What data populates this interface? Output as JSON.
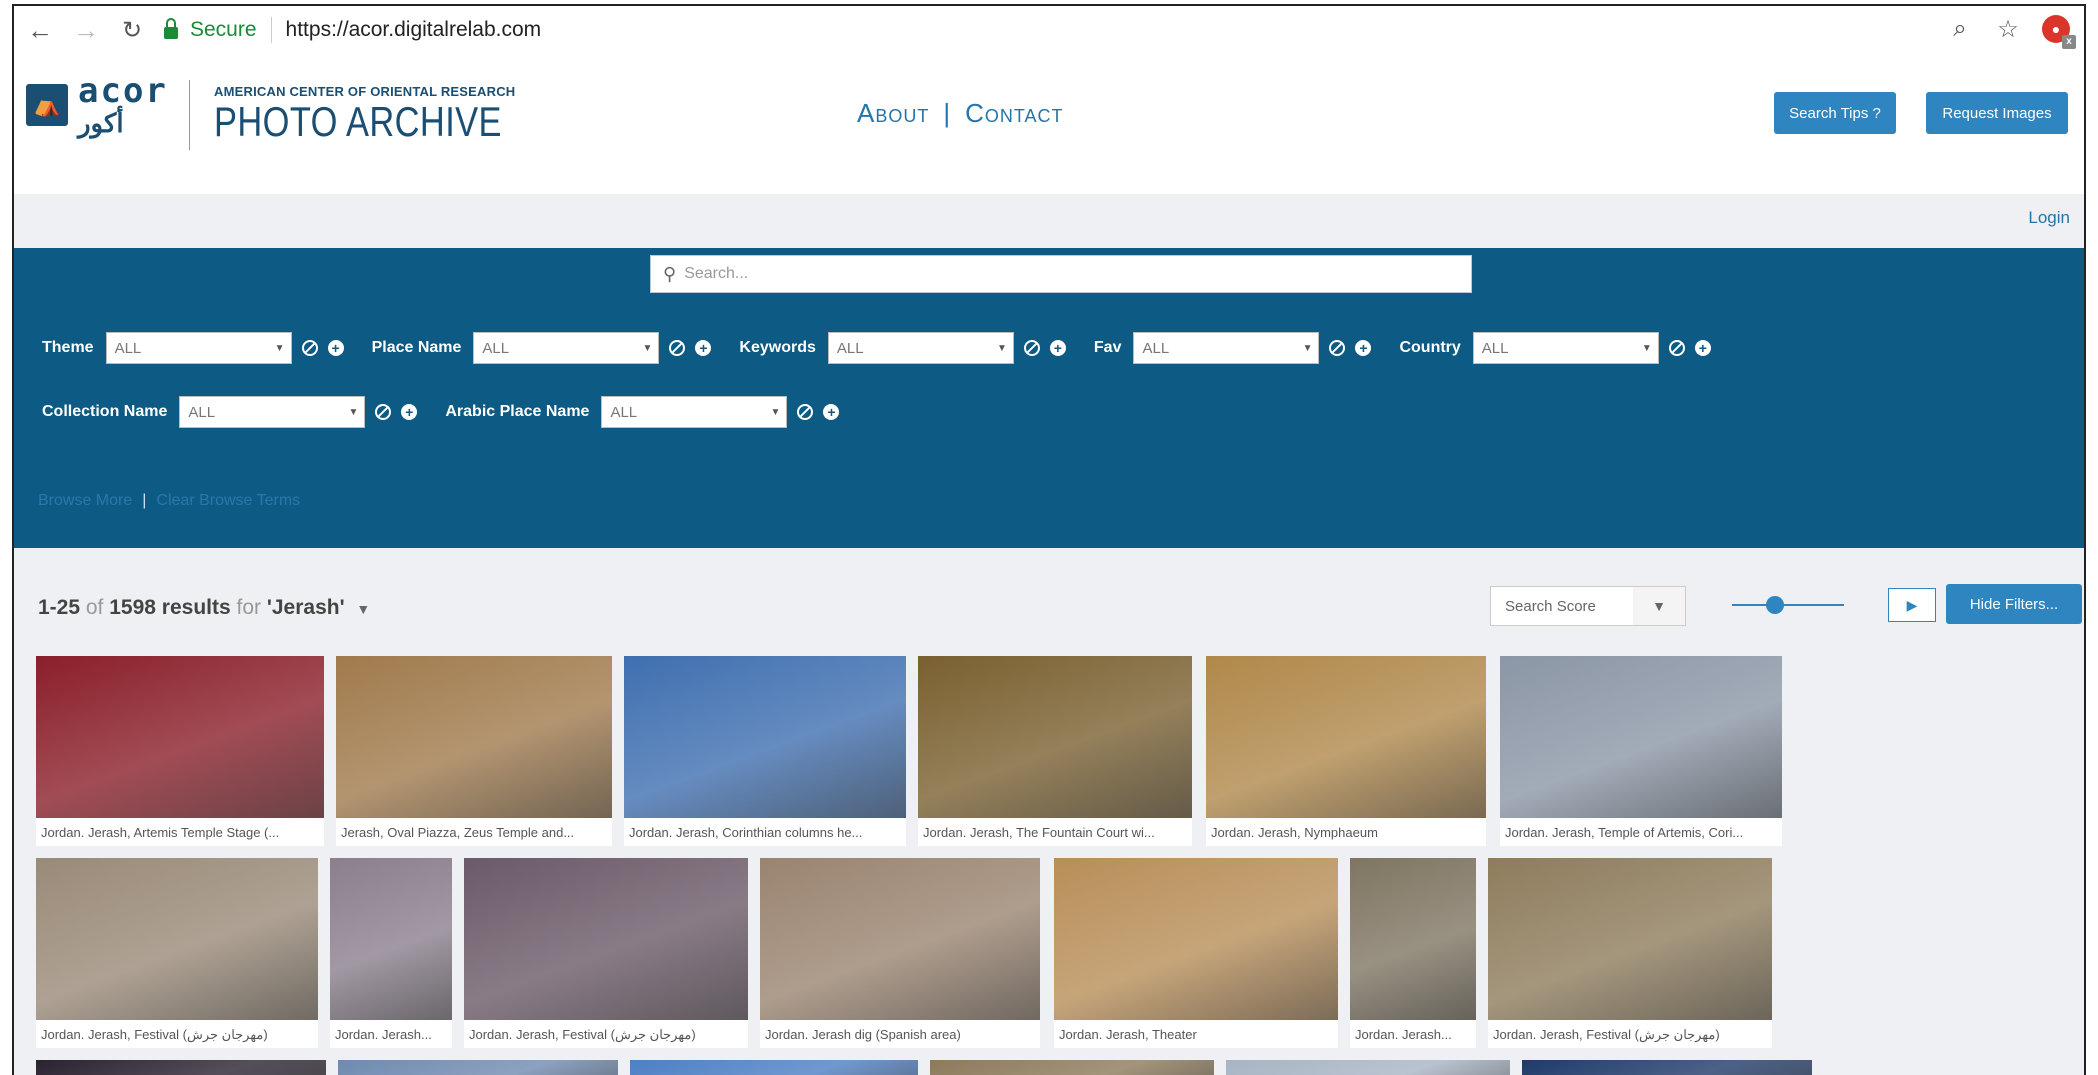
{
  "browser": {
    "secure_label": "Secure",
    "url": "https://acor.digitalrelab.com"
  },
  "header": {
    "logo_en": "acor",
    "logo_ar": "أكور",
    "subtitle": "AMERICAN CENTER OF ORIENTAL RESEARCH",
    "title": "PHOTO ARCHIVE",
    "nav": {
      "about": "About",
      "contact": "Contact",
      "separator": "|"
    },
    "search_tips_label": "Search Tips ?",
    "request_images_label": "Request Images"
  },
  "login_label": "Login",
  "search": {
    "placeholder": "Search..."
  },
  "filters": [
    {
      "label": "Theme",
      "value": "ALL"
    },
    {
      "label": "Place Name",
      "value": "ALL"
    },
    {
      "label": "Keywords",
      "value": "ALL"
    },
    {
      "label": "Fav",
      "value": "ALL"
    },
    {
      "label": "Country",
      "value": "ALL"
    },
    {
      "label": "Collection Name",
      "value": "ALL"
    },
    {
      "label": "Arabic Place Name",
      "value": "ALL"
    }
  ],
  "browse": {
    "more": "Browse More",
    "separator": "|",
    "clear": "Clear Browse Terms"
  },
  "results": {
    "range": "1-25",
    "of": "of",
    "total": "1598 results",
    "for": "for",
    "query": "'Jerash'",
    "sort_label": "Search Score",
    "hide_filters_label": "Hide Filters..."
  },
  "thumbnails": [
    {
      "caption": "Jordan. Jerash, Artemis Temple Stage (...",
      "color": "#8a1f2a"
    },
    {
      "caption": "Jerash, Oval Piazza, Zeus Temple and...",
      "color": "#a07a4c"
    },
    {
      "caption": "Jordan. Jerash, Corinthian columns he...",
      "color": "#3f6fb0"
    },
    {
      "caption": "Jordan. Jerash, The Fountain Court wi...",
      "color": "#7a6030"
    },
    {
      "caption": "Jordan. Jerash, Nymphaeum",
      "color": "#b0884a"
    },
    {
      "caption": "Jordan. Jerash, Temple of Artemis, Cori...",
      "color": "#8b96a6"
    },
    {
      "caption": "Jordan. Jerash, Festival (مهرجان جرش)",
      "color": "#9a8a78"
    },
    {
      "caption": "Jordan. Jerash...",
      "color": "#8a7f8c"
    },
    {
      "caption": "Jordan. Jerash, Festival (مهرجان جرش)",
      "color": "#6b5a68"
    },
    {
      "caption": "Jordan. Jerash dig (Spanish area)",
      "color": "#9a8470"
    },
    {
      "caption": "Jordan. Jerash, Theater",
      "color": "#b88e58"
    },
    {
      "caption": "Jordan. Jerash...",
      "color": "#7f7562"
    },
    {
      "caption": "Jordan. Jerash, Festival (مهرجان جرش)",
      "color": "#8e7c5c"
    },
    {
      "caption": "",
      "color": "#2a2230"
    },
    {
      "caption": "",
      "color": "#6f8ab0"
    },
    {
      "caption": "",
      "color": "#4d7fc4"
    },
    {
      "caption": "",
      "color": "#8c7a5a"
    },
    {
      "caption": "",
      "color": "#a8b4c4"
    },
    {
      "caption": "",
      "color": "#1f3a6a"
    }
  ]
}
